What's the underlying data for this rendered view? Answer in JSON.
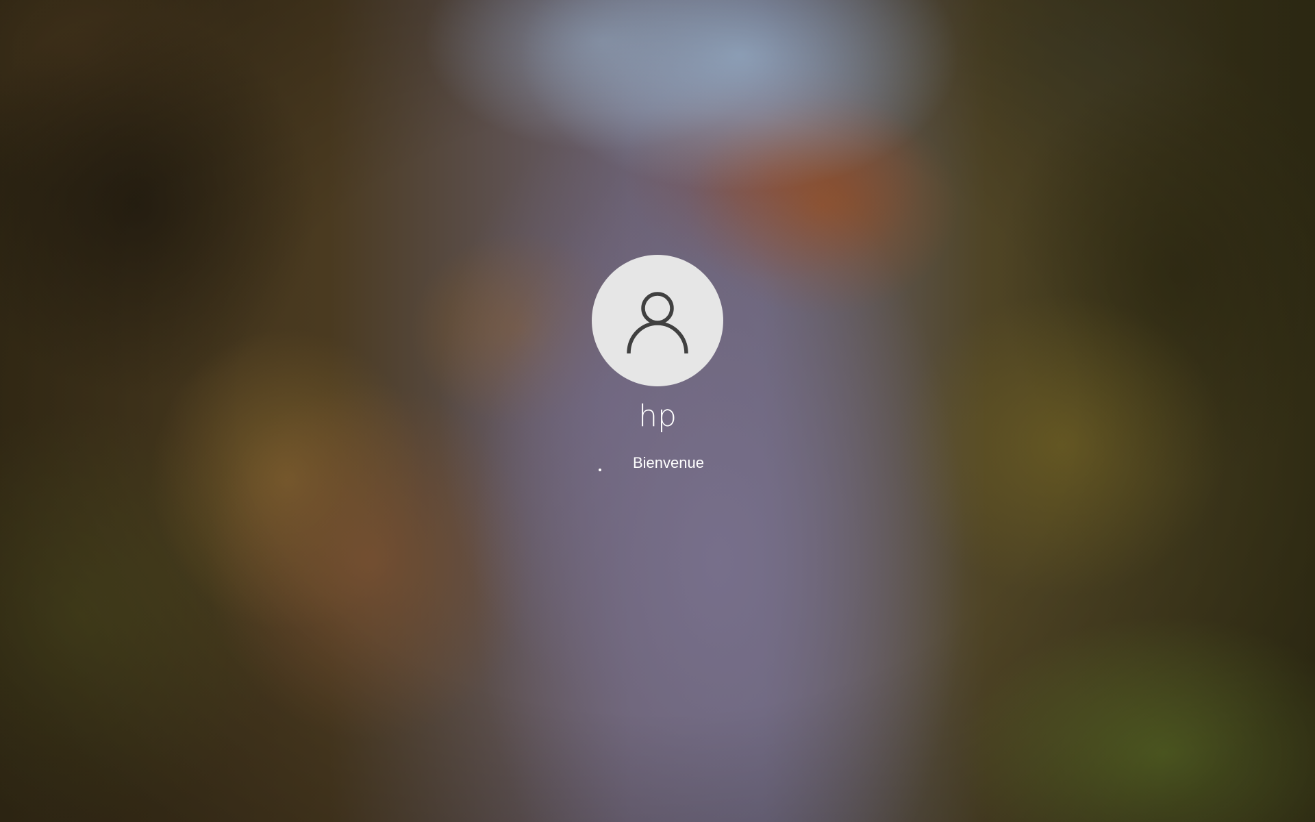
{
  "login": {
    "username": "hp",
    "status_text": "Bienvenue",
    "avatar_icon": "user-icon",
    "spinner_icon": "loading-spinner-icon"
  },
  "colors": {
    "avatar_background": "#e6e6e6",
    "avatar_icon_stroke": "#404040",
    "text": "#ffffff"
  }
}
